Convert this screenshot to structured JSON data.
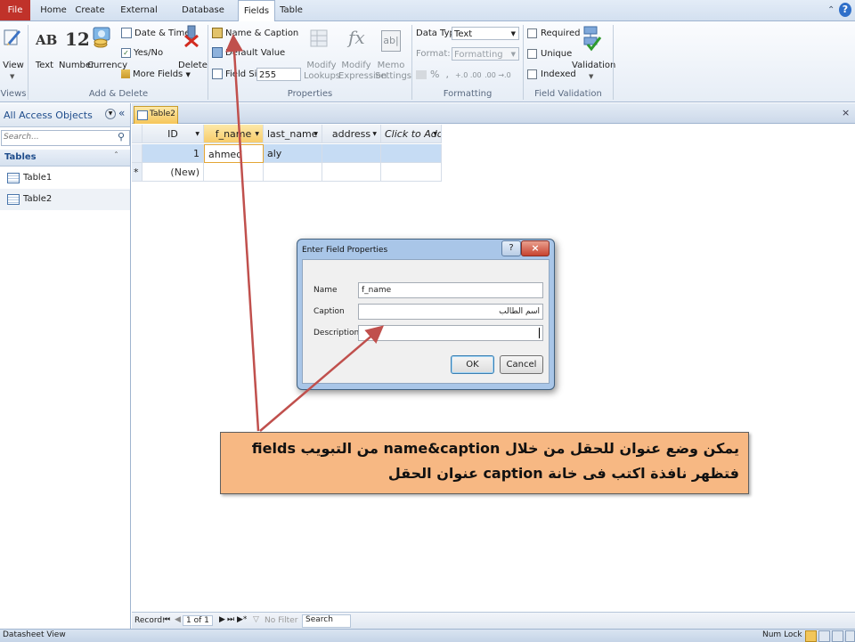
{
  "tabs": {
    "file": "File",
    "home": "Home",
    "create": "Create",
    "external": "External Data",
    "dbtools": "Database Tools",
    "fields": "Fields",
    "table": "Table"
  },
  "ribbon": {
    "views": {
      "view_label": "View",
      "group_label": "Views"
    },
    "add_delete": {
      "text": "Text",
      "number": "Number",
      "currency": "Currency",
      "date_time": "Date & Time",
      "yes_no": "Yes/No",
      "more_fields": "More Fields",
      "delete": "Delete",
      "group_label": "Add & Delete",
      "ab_glyph": "AB",
      "num_glyph": "12"
    },
    "properties": {
      "name_caption": "Name & Caption",
      "default_value": "Default Value",
      "field_size_label": "Field Size",
      "field_size_value": "255",
      "modify_lookups_1": "Modify",
      "modify_lookups_2": "Lookups",
      "modify_expr_1": "Modify",
      "modify_expr_2": "Expression",
      "memo_1": "Memo",
      "memo_2": "Settings",
      "group_label": "Properties"
    },
    "formatting": {
      "data_type_label": "Data Type:",
      "data_type_value": "Text",
      "format_label": "Format:",
      "format_value": "Formatting",
      "group_label": "Formatting"
    },
    "validation": {
      "required": "Required",
      "unique": "Unique",
      "indexed": "Indexed",
      "validation_label": "Validation",
      "group_label": "Field Validation"
    }
  },
  "nav": {
    "header": "All Access Objects",
    "search_placeholder": "Search...",
    "section": "Tables",
    "items": [
      {
        "label": "Table1"
      },
      {
        "label": "Table2"
      }
    ]
  },
  "document": {
    "tab_label": "Table2",
    "columns": [
      "ID",
      "f_name",
      "last_name",
      "address",
      "Click to Add"
    ],
    "rows": [
      {
        "id": "1",
        "f_name": "ahmed",
        "last_name": "aly",
        "address": ""
      }
    ],
    "new_row": "(New)",
    "new_marker": "*"
  },
  "record_nav": {
    "label": "Record:",
    "position": "1 of 1",
    "filter": "No Filter",
    "search": "Search"
  },
  "status": {
    "left": "Datasheet View",
    "right": "Num Lock"
  },
  "dialog": {
    "title": "Enter Field Properties",
    "name_label": "Name",
    "name_value": "f_name",
    "caption_label": "Caption",
    "caption_value": "اسم الطالب",
    "description_label": "Description",
    "description_value": "",
    "ok": "OK",
    "cancel": "Cancel"
  },
  "callout": {
    "line1": "يمكن وضع عنوان للحقل من خلال name&caption من التبويب fields",
    "line2": "فتظهر نافذة اكتب فى خانة caption عنوان الحقل"
  },
  "colors": {
    "file_tab": "#c0322a",
    "callout_bg": "#f7b883",
    "arrow": "#c0504d",
    "selected_row": "#c6dcf4"
  }
}
